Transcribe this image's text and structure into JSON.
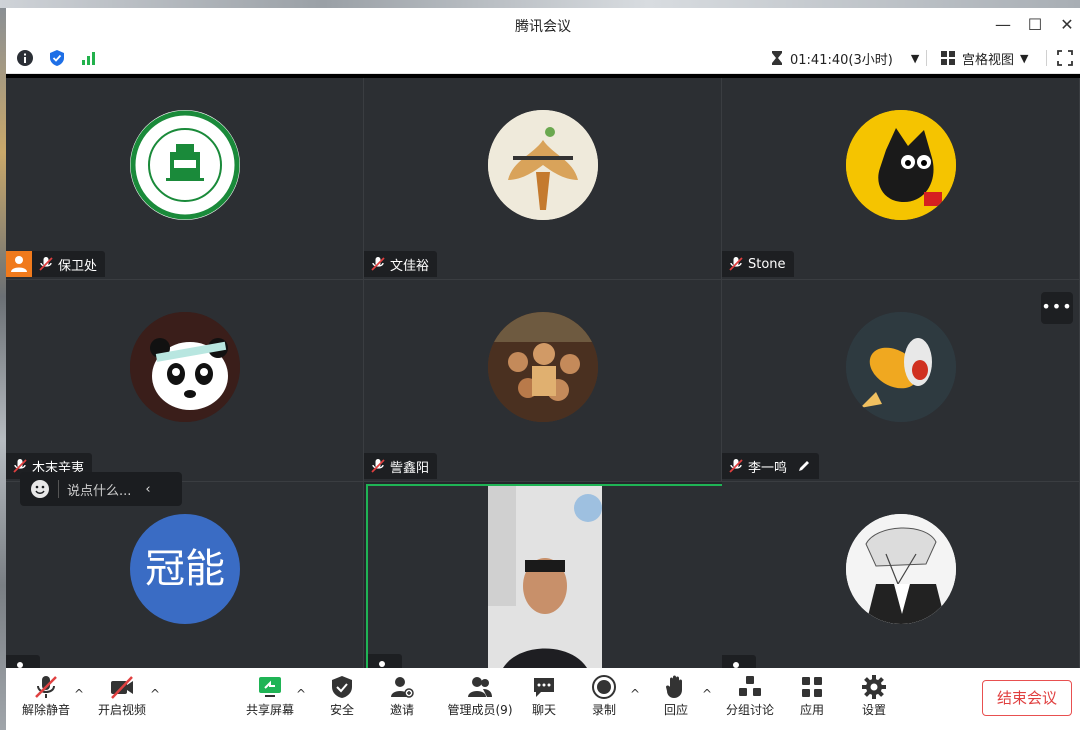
{
  "window": {
    "title": "腾讯会议"
  },
  "topbar": {
    "timer": "01:41:40(3小时)",
    "view_label": "宫格视图"
  },
  "participants": [
    {
      "name": "保卫处"
    },
    {
      "name": "文佳裕"
    },
    {
      "name": "Stone"
    },
    {
      "name": "木末辛夷"
    },
    {
      "name": "訾鑫阳"
    },
    {
      "name": "李一鸣"
    },
    {
      "name": "",
      "avatar_text": "冠能"
    },
    {
      "name": ""
    },
    {
      "name": ""
    }
  ],
  "chat_popup": {
    "placeholder": "说点什么..."
  },
  "bottombar": {
    "unmute": "解除静音",
    "video": "开启视频",
    "share": "共享屏幕",
    "security": "安全",
    "invite": "邀请",
    "members": "管理成员(9)",
    "chat": "聊天",
    "record": "录制",
    "react": "回应",
    "breakout": "分组讨论",
    "apps": "应用",
    "settings": "设置",
    "end": "结束会议"
  },
  "colors": {
    "accent_green": "#1fb455",
    "end_red": "#e04040",
    "host_orange": "#f07a1c"
  }
}
